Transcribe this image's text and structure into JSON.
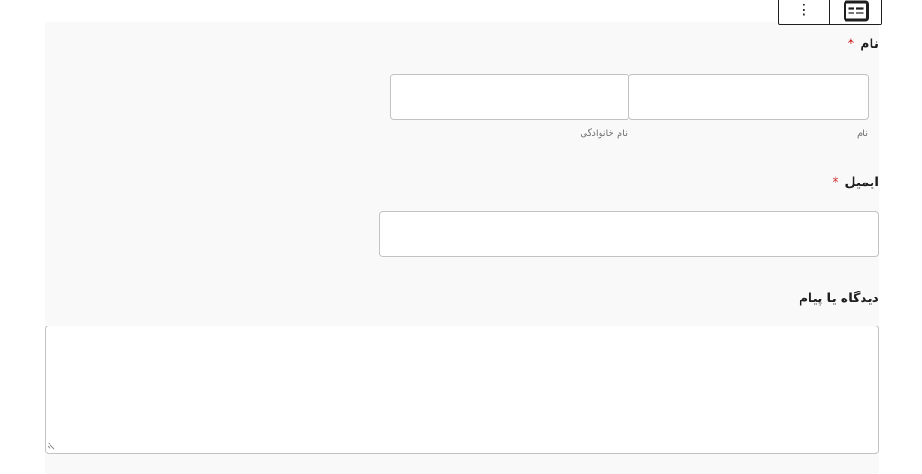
{
  "toolbar": {
    "more_icon": "vertical-ellipsis-icon",
    "more_glyph": "⋮",
    "form_icon": "form-block-icon"
  },
  "form": {
    "name": {
      "label": "نام",
      "required_mark": "*",
      "first": {
        "sublabel": "نام",
        "value": ""
      },
      "last": {
        "sublabel": "نام خانوادگی",
        "value": ""
      }
    },
    "email": {
      "label": "ایمیل",
      "required_mark": "*",
      "value": ""
    },
    "comment": {
      "label": "دیدگاه یا پیام",
      "value": "",
      "resize_icon": "resize-handle-icon"
    }
  },
  "colors": {
    "required": "#cc1818",
    "field_border": "#c3c3c3",
    "form_background": "#f9f9f9"
  }
}
